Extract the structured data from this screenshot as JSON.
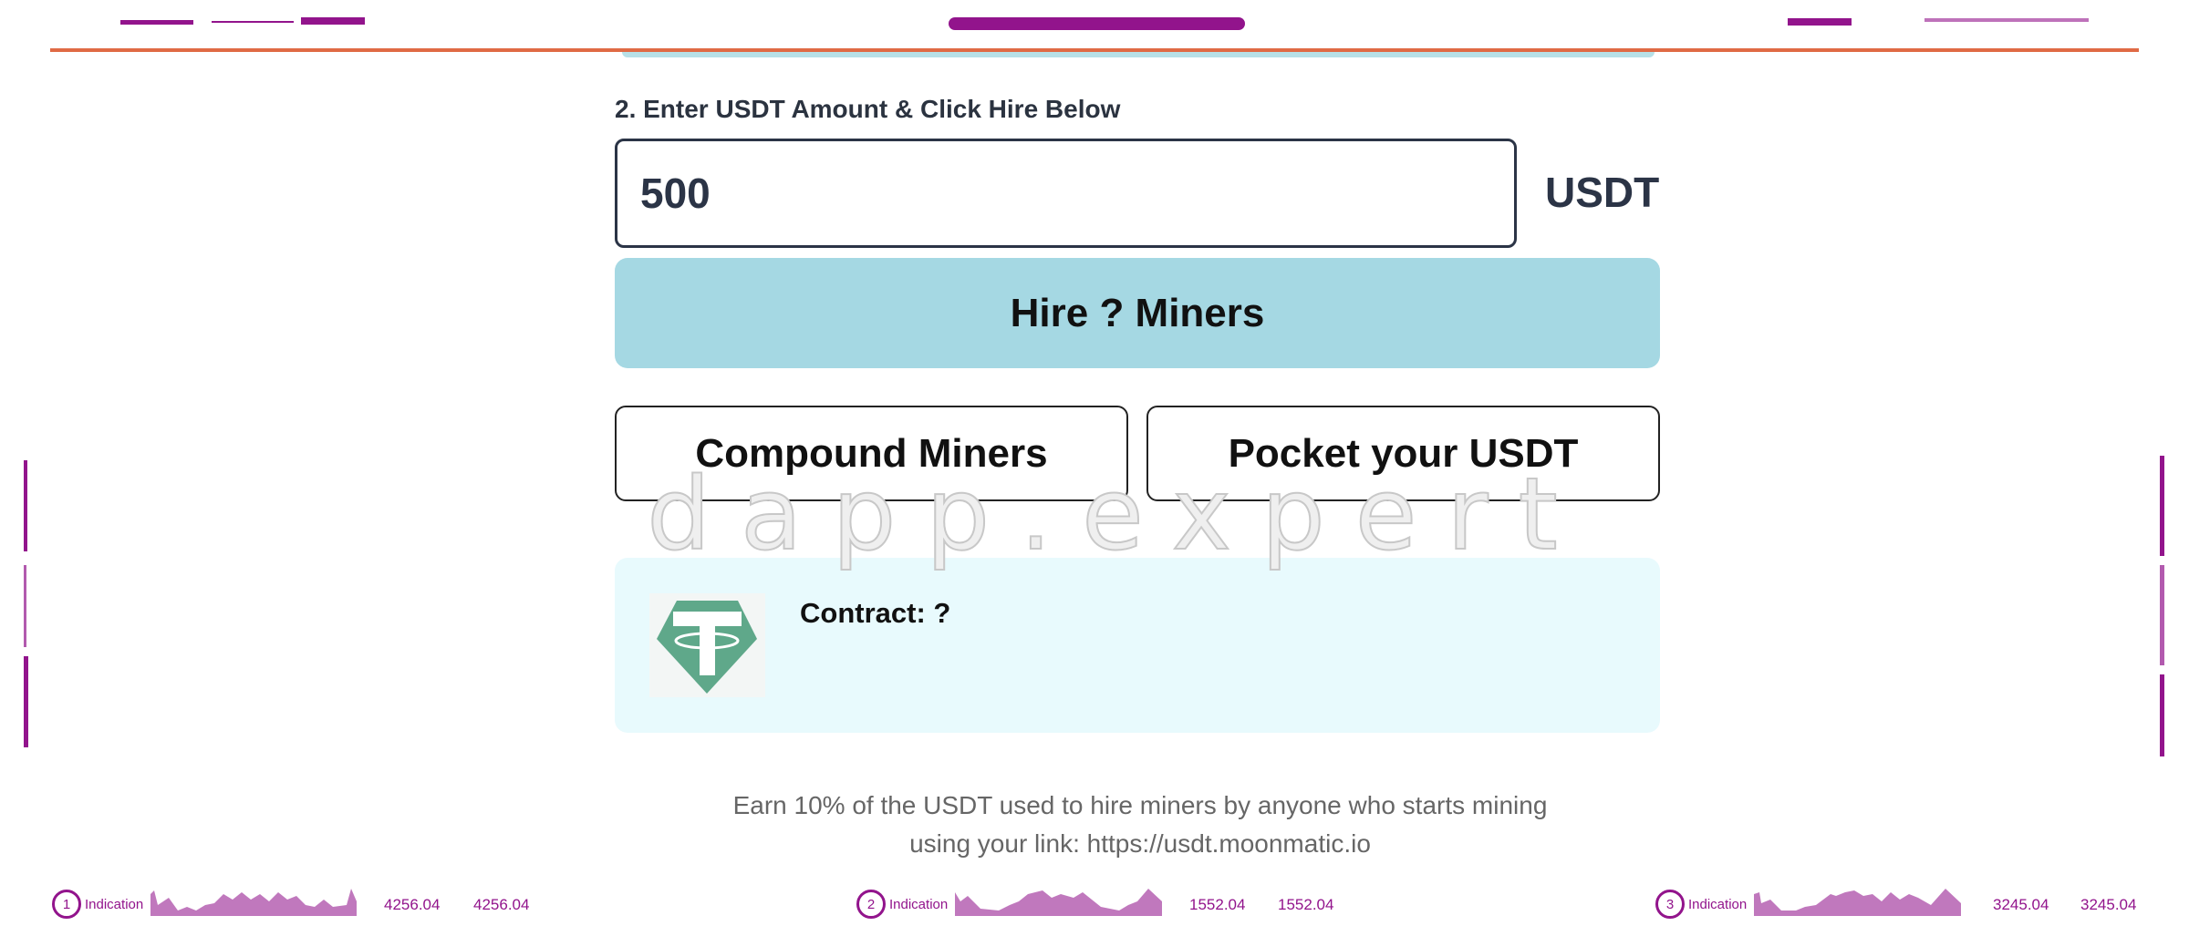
{
  "header_decor": {
    "accent": "#92148c",
    "line_color": "#e06a45"
  },
  "form": {
    "step_label": "2. Enter USDT Amount & Click Hire Below",
    "amount_value": "500",
    "unit": "USDT",
    "hire_button": "Hire ? Miners",
    "compound_button": "Compound Miners",
    "pocket_button": "Pocket your USDT"
  },
  "watermark": "dapp.expert",
  "contract": {
    "label": "Contract: ?",
    "logo_icon": "tether-icon",
    "logo_color": "#5fa88a"
  },
  "footer": {
    "line1": "Earn 10% of the USDT used to hire miners by anyone who starts mining",
    "line2": "using your link: https://usdt.moonmatic.io"
  },
  "indicators": [
    {
      "num": "1",
      "label": "Indication",
      "value_a": "4256.04",
      "value_b": "4256.04"
    },
    {
      "num": "2",
      "label": "Indication",
      "value_a": "1552.04",
      "value_b": "1552.04"
    },
    {
      "num": "3",
      "label": "Indication",
      "value_a": "3245.04",
      "value_b": "3245.04"
    }
  ]
}
